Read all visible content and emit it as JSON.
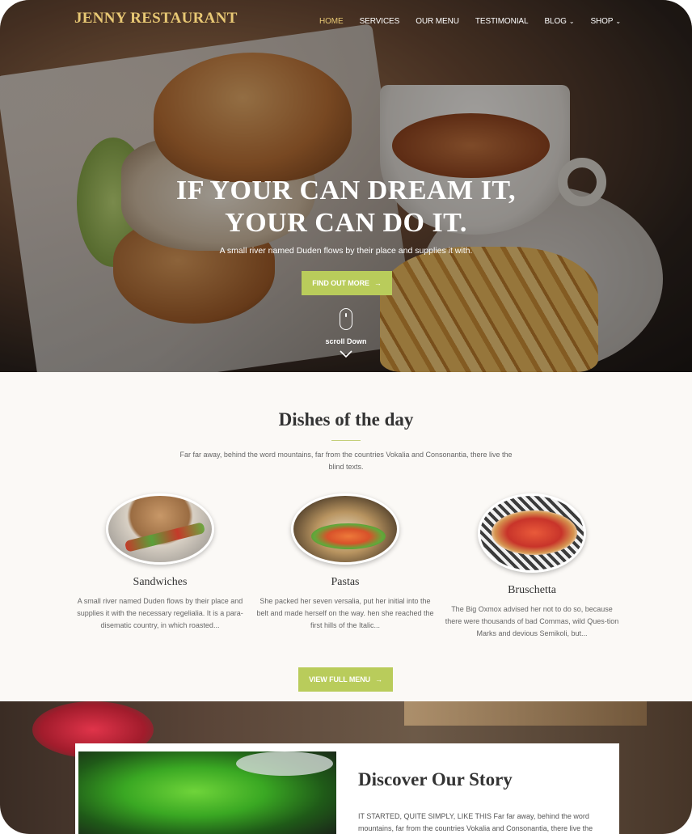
{
  "nav": {
    "brand": "JENNY RESTAURANT",
    "items": [
      {
        "label": "HOME",
        "active": true
      },
      {
        "label": "SERVICES"
      },
      {
        "label": "OUR MENU"
      },
      {
        "label": "TESTIMONIAL"
      },
      {
        "label": "BLOG",
        "dropdown": true
      },
      {
        "label": "SHOP",
        "dropdown": true
      }
    ]
  },
  "hero": {
    "title_line1": "IF YOUR CAN DREAM IT,",
    "title_line2": "YOUR CAN DO IT.",
    "subtitle": "A small river named Duden flows by their place and supplies it with.",
    "button_label": "FIND OUT MORE",
    "scroll_label": "scroll Down"
  },
  "dishes": {
    "title": "Dishes of the day",
    "description": "Far far away, behind the word mountains, far from the countries Vokalia and Consonantia, there live the blind texts.",
    "items": [
      {
        "name": "Sandwiches",
        "text": "A small river named Duden flows by their place and supplies it with the necessary regelialia. It is a para-disematic country, in which roasted..."
      },
      {
        "name": "Pastas",
        "text": "She packed her seven versalia, put her initial into the belt and made herself on the way. hen she reached the first hills of the Italic..."
      },
      {
        "name": "Bruschetta",
        "text": "The Big Oxmox advised her not to do so, because there were thousands of bad Commas, wild Ques-tion Marks and devious Semikoli, but..."
      }
    ],
    "button_label": "VIEW FULL MENU"
  },
  "story": {
    "title": "Discover Our Story",
    "text": "IT STARTED, QUITE SIMPLY, LIKE THIS Far far away, behind the word mountains, far from the countries Vokalia and Consonantia, there live the"
  },
  "colors": {
    "accent_green": "#b9cc5b",
    "brand_gold": "#e8c874",
    "section_bg": "#fbf9f6"
  }
}
